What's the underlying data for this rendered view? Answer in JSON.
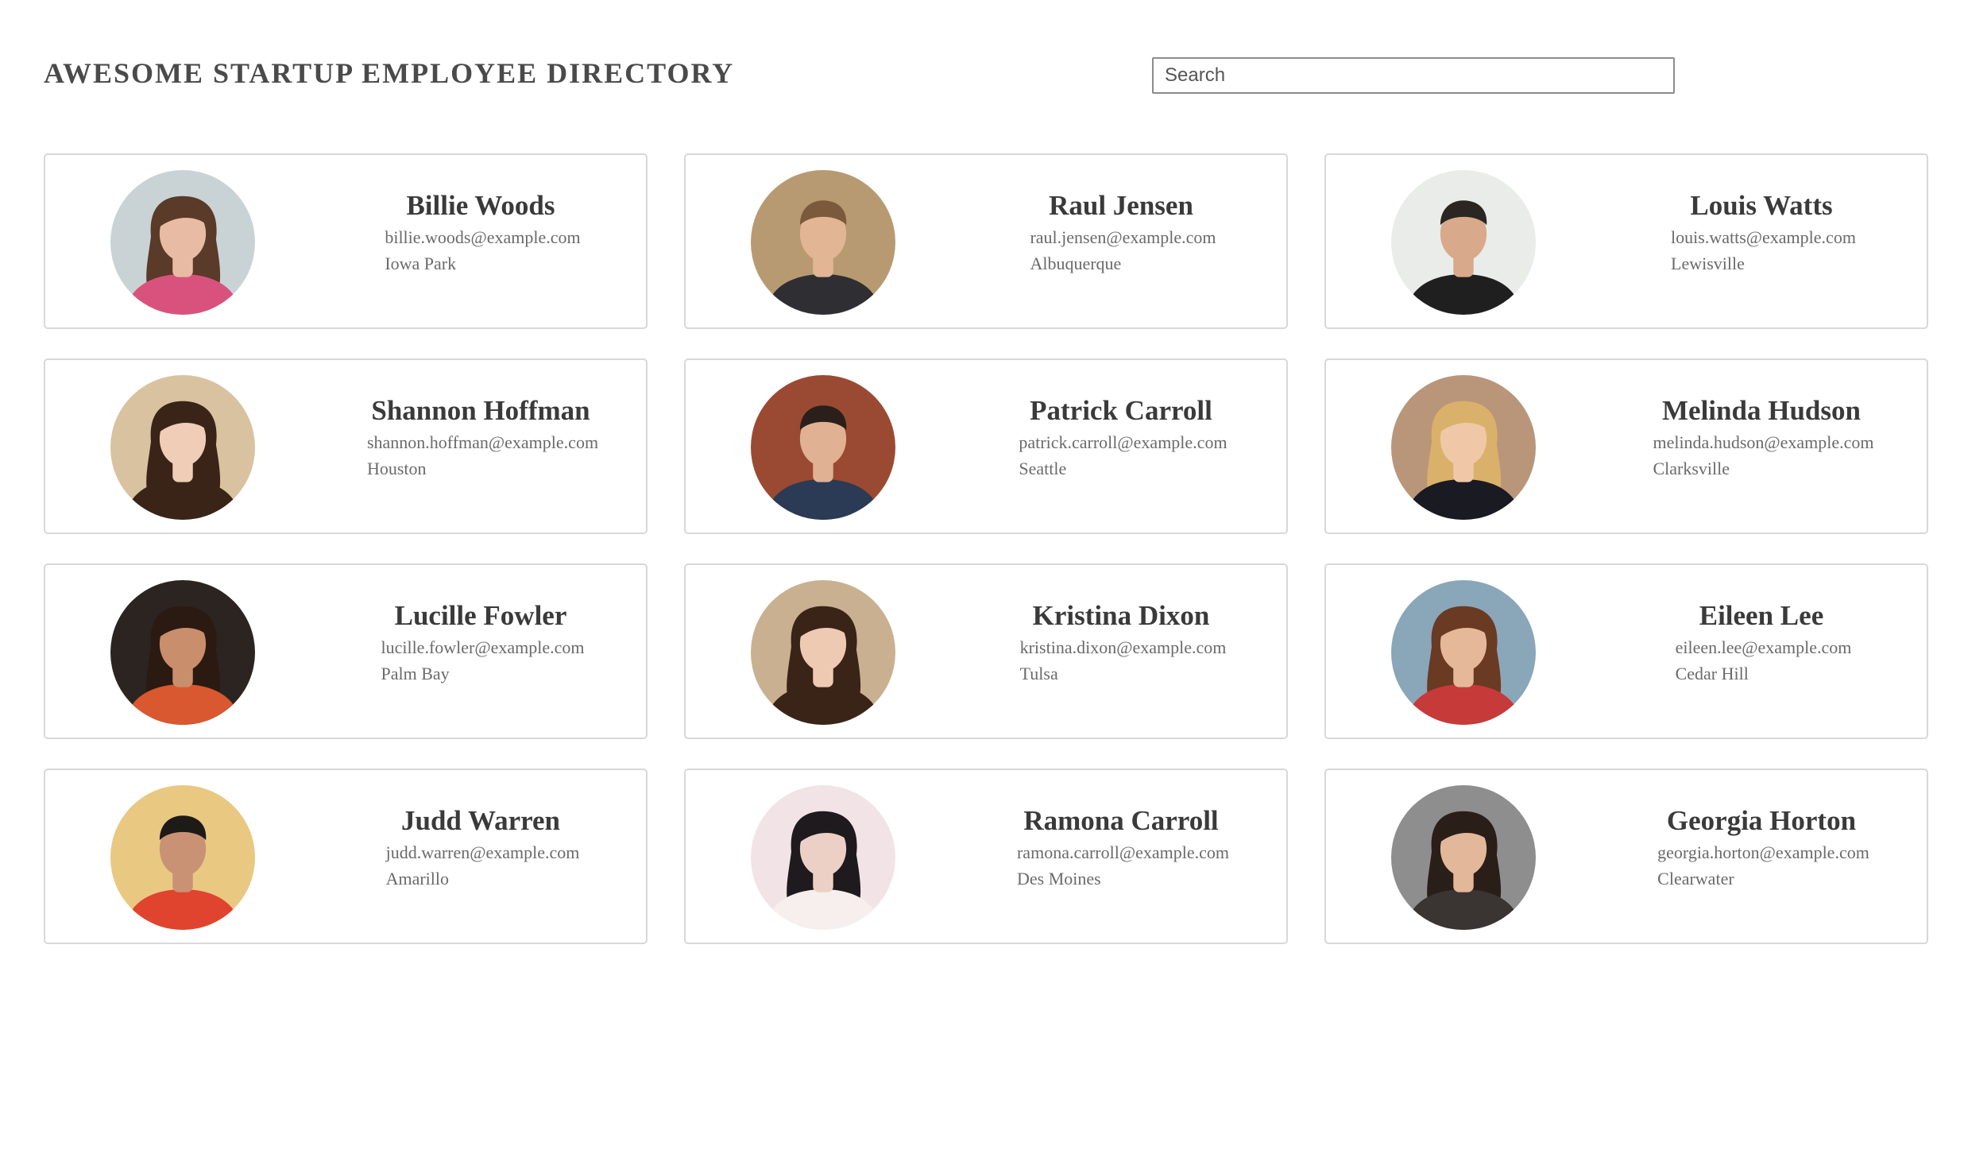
{
  "header": {
    "title": "AWESOME STARTUP EMPLOYEE DIRECTORY",
    "search_placeholder": "Search"
  },
  "employees": [
    {
      "name": "Billie Woods",
      "email": "billie.woods@example.com",
      "city": "Iowa Park",
      "photo": {
        "bg": "#c9d3d6",
        "hair": "#5a3a28",
        "skin": "#e8bca4",
        "shirt": "#d9527d"
      }
    },
    {
      "name": "Raul Jensen",
      "email": "raul.jensen@example.com",
      "city": "Albuquerque",
      "photo": {
        "bg": "#b89a72",
        "hair": "#7a5a3a",
        "skin": "#e2b594",
        "shirt": "#2f2f33"
      }
    },
    {
      "name": "Louis Watts",
      "email": "louis.watts@example.com",
      "city": "Lewisville",
      "photo": {
        "bg": "#e9ece9",
        "hair": "#2a2622",
        "skin": "#d8a98a",
        "shirt": "#1f1f1f"
      }
    },
    {
      "name": "Shannon Hoffman",
      "email": "shannon.hoffman@example.com",
      "city": "Houston",
      "photo": {
        "bg": "#d9c2a0",
        "hair": "#3a2418",
        "skin": "#f0cdb6",
        "shirt": "#3a2418"
      }
    },
    {
      "name": "Patrick Carroll",
      "email": "patrick.carroll@example.com",
      "city": "Seattle",
      "photo": {
        "bg": "#9a4a32",
        "hair": "#2a1f1a",
        "skin": "#e0b193",
        "shirt": "#2b3a55"
      }
    },
    {
      "name": "Melinda Hudson",
      "email": "melinda.hudson@example.com",
      "city": "Clarksville",
      "photo": {
        "bg": "#b9967a",
        "hair": "#d9b16a",
        "skin": "#f0c8a8",
        "shirt": "#1a1a22"
      }
    },
    {
      "name": "Lucille Fowler",
      "email": "lucille.fowler@example.com",
      "city": "Palm Bay",
      "photo": {
        "bg": "#2b2420",
        "hair": "#2a1a12",
        "skin": "#c98e6b",
        "shirt": "#d9582f"
      }
    },
    {
      "name": "Kristina Dixon",
      "email": "kristina.dixon@example.com",
      "city": "Tulsa",
      "photo": {
        "bg": "#c9b090",
        "hair": "#3a2418",
        "skin": "#efcab2",
        "shirt": "#3a2418"
      }
    },
    {
      "name": "Eileen Lee",
      "email": "eileen.lee@example.com",
      "city": "Cedar Hill",
      "photo": {
        "bg": "#8aa6b9",
        "hair": "#6a3a22",
        "skin": "#e6b89a",
        "shirt": "#c63a3a"
      }
    },
    {
      "name": "Judd Warren",
      "email": "judd.warren@example.com",
      "city": "Amarillo",
      "photo": {
        "bg": "#e9c882",
        "hair": "#1e1a18",
        "skin": "#c99274",
        "shirt": "#e0442e"
      }
    },
    {
      "name": "Ramona Carroll",
      "email": "ramona.carroll@example.com",
      "city": "Des Moines",
      "photo": {
        "bg": "#f2e4e6",
        "hair": "#1e1a1e",
        "skin": "#ecd0c6",
        "shirt": "#f6efee"
      }
    },
    {
      "name": "Georgia Horton",
      "email": "georgia.horton@example.com",
      "city": "Clearwater",
      "photo": {
        "bg": "#8e8e8e",
        "hair": "#2a1e18",
        "skin": "#e2b79a",
        "shirt": "#3a3432"
      }
    }
  ]
}
